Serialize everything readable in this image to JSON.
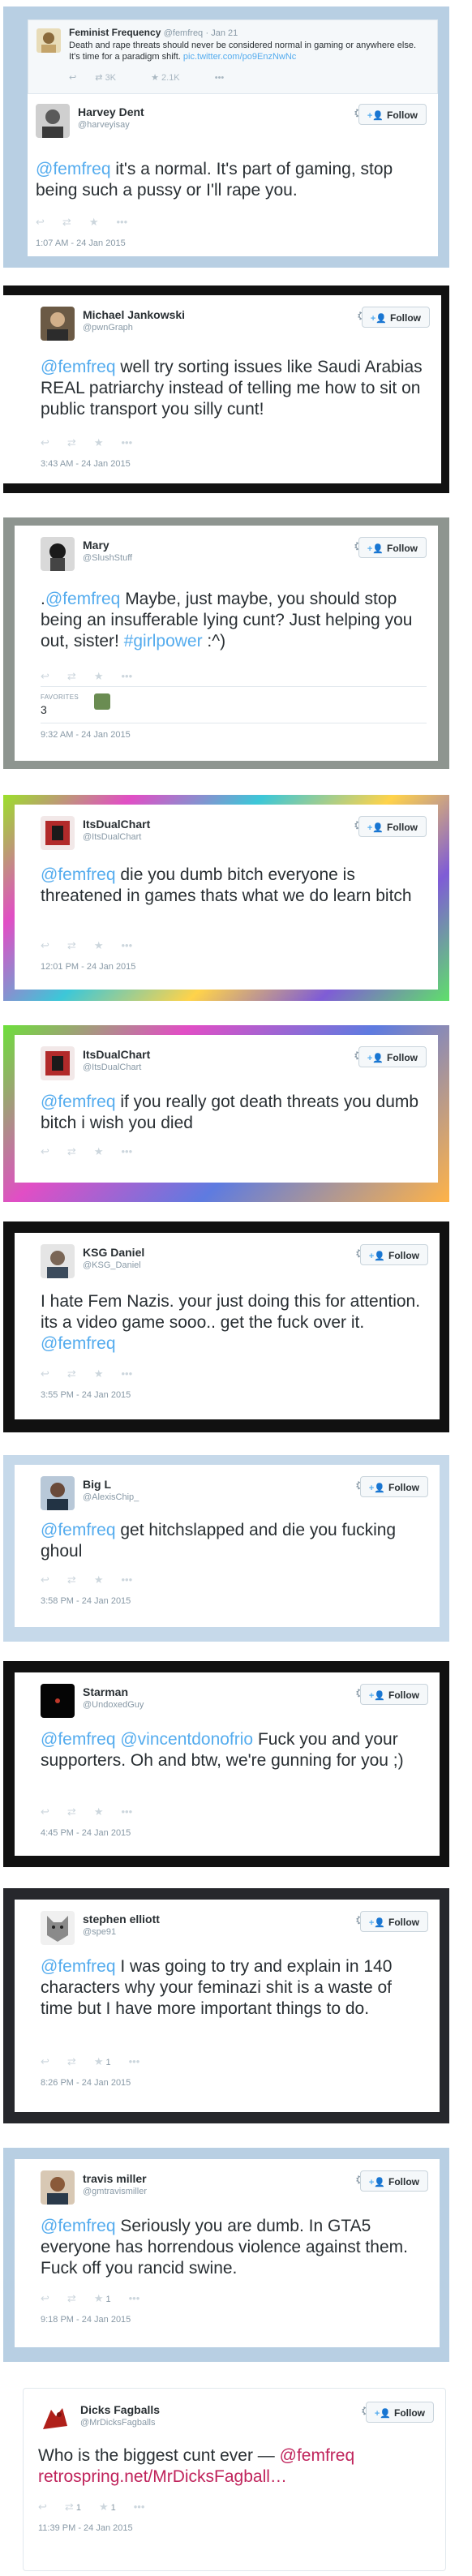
{
  "colors": {
    "link": "#55acee",
    "muted": "#8899a6",
    "text": "#292f33",
    "follow_icon": "#55acee",
    "retrospring_link": "#c0245c"
  },
  "follow_label": "Follow",
  "quoted": {
    "name": "Feminist Frequency",
    "handle": "@femfreq",
    "date": "· Jan 21",
    "text": "Death and rape threats should never be considered normal in gaming or anywhere else. It's time for a paradigm shift.",
    "link": "pic.twitter.com/po9EnzNwNc",
    "retweets": "3K",
    "favorites": "2.1K"
  },
  "tweets": [
    {
      "name": "Harvey Dent",
      "handle": "@harveyisay",
      "mention": "@femfreq",
      "text": " it's a normal. It's  part of gaming, stop being such a pussy or I'll rape you.",
      "time": "1:07 AM - 24 Jan 2015"
    },
    {
      "name": "Michael Jankowski",
      "handle": "@pwnGraph",
      "mention": "@femfreq",
      "text": " well try sorting issues like Saudi Arabias REAL patriarchy instead of telling me how to sit on public transport you silly cunt!",
      "time": "3:43 AM - 24 Jan 2015"
    },
    {
      "name": "Mary",
      "handle": "@SlushStuff",
      "prefix": ".",
      "mention": "@femfreq",
      "text": " Maybe, just maybe, you should stop being an insufferable lying cunt? Just helping you out, sister! ",
      "hashtag": "#girlpower",
      "suffix": " :^)",
      "favorites_label": "FAVORITES",
      "favorites_count": "3",
      "time": "9:32 AM - 24 Jan 2015"
    },
    {
      "name": "ItsDualChart",
      "handle": "@ItsDualChart",
      "mention": "@femfreq",
      "text": " die you dumb bitch everyone is threatened in games thats what we do learn bitch",
      "time": "12:01 PM - 24 Jan 2015"
    },
    {
      "name": "ItsDualChart",
      "handle": "@ItsDualChart",
      "mention": "@femfreq",
      "text": " if you really got death threats you dumb bitch i wish you died"
    },
    {
      "name": "KSG Daniel",
      "handle": "@KSG_Daniel",
      "text": "I hate Fem Nazis. your just doing this for attention. its a video game sooo.. get the fuck over it.  ",
      "mention": "@femfreq",
      "time": "3:55 PM - 24 Jan 2015"
    },
    {
      "name": "Big L",
      "handle": "@AlexisChip_",
      "mention": "@femfreq",
      "text": " get hitchslapped and die you fucking ghoul",
      "time": "3:58 PM - 24 Jan 2015"
    },
    {
      "name": "Starman",
      "handle": "@UndoxedGuy",
      "mention": "@femfreq",
      "mention2": "@vincentdonofrio",
      "text": " Fuck you and your supporters. Oh and btw, we're gunning for you ;)",
      "time": "4:45 PM - 24 Jan 2015"
    },
    {
      "name": "stephen elliott",
      "handle": "@spe91",
      "mention": "@femfreq",
      "text": " I was going to try and explain in 140 characters why your feminazi shit is a waste of time but I have more important things to do.",
      "favorites": "1",
      "time": "8:26 PM - 24 Jan 2015"
    },
    {
      "name": "travis miller",
      "handle": "@gmtravismiller",
      "mention": "@femfreq",
      "text": " Seriously you are dumb. In GTA5 everyone has horrendous violence against them. Fuck off you rancid swine.",
      "favorites": "1",
      "time": "9:18 PM - 24 Jan 2015"
    },
    {
      "name": "Dicks Fagballs",
      "handle": "@MrDicksFagballs",
      "text": "Who is the biggest cunt ever — ",
      "mention": "@femfreq",
      "link": "retrospring.net/MrDicksFagball…",
      "retweets": "1",
      "favorites": "1",
      "time": "11:39 PM - 24 Jan 2015"
    }
  ]
}
